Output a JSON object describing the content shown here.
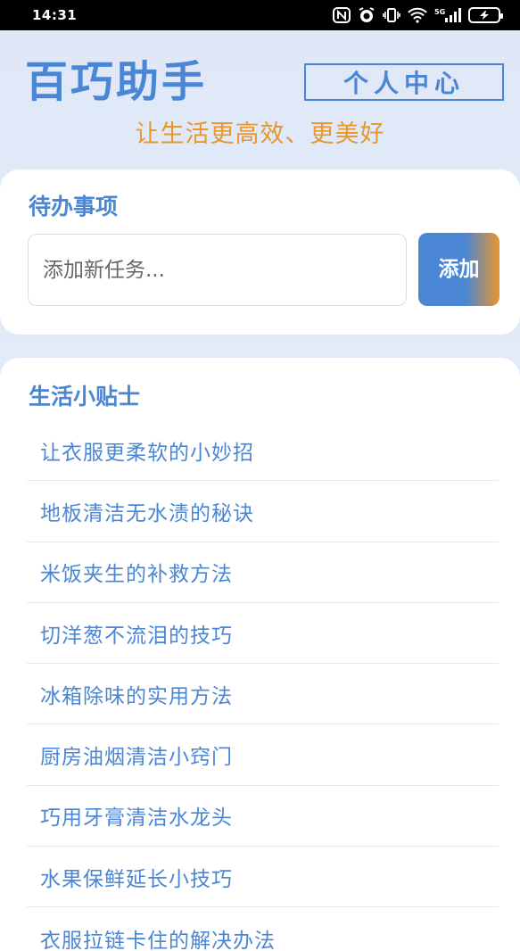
{
  "status_bar": {
    "time": "14:31",
    "nfc": "N",
    "vibrate": "⁞0⁞",
    "network": "5G",
    "battery_icon": "battery-charging-icon"
  },
  "header": {
    "title": "百巧助手",
    "profile_button": "个人中心",
    "slogan": "让生活更高效、更美好"
  },
  "todo": {
    "title": "待办事项",
    "input_placeholder": "添加新任务...",
    "input_value": "",
    "add_button": "添加"
  },
  "tips": {
    "title": "生活小贴士",
    "items": [
      "让衣服更柔软的小妙招",
      "地板清洁无水渍的秘诀",
      "米饭夹生的补救方法",
      "切洋葱不流泪的技巧",
      "冰箱除味的实用方法",
      "厨房油烟清洁小窍门",
      "巧用牙膏清洁水龙头",
      "水果保鲜延长小技巧",
      "衣服拉链卡住的解决办法"
    ]
  },
  "colors": {
    "primary": "#4a86d4",
    "accent": "#e8962e",
    "background": "#e3ebf8"
  }
}
